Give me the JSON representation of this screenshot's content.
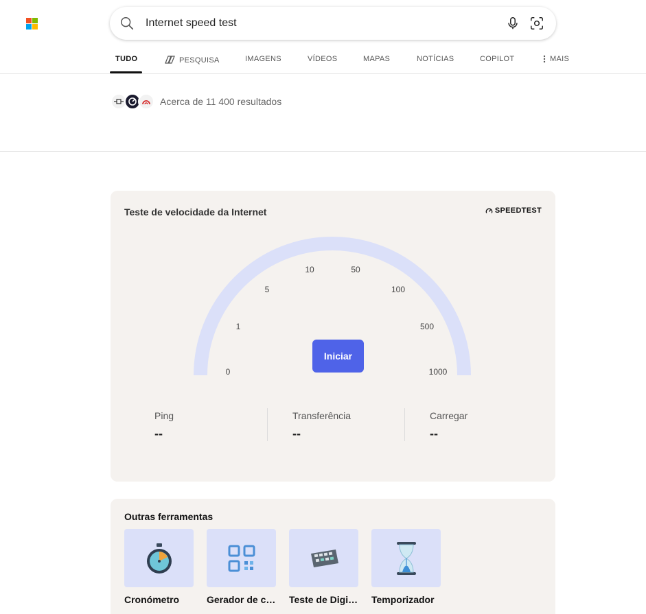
{
  "search": {
    "query": "Internet speed test"
  },
  "colors": {
    "accent": "#4f63e8",
    "gauge_track": "#dbe0f9",
    "card_bg": "#f5f2ef",
    "ms_red": "#f25022",
    "ms_green": "#7fba00",
    "ms_blue": "#00a4ef",
    "ms_yellow": "#ffb900"
  },
  "tabs": [
    {
      "label": "TUDO",
      "active": true
    },
    {
      "label": "PESQUISA",
      "icon": "copilot-search-icon"
    },
    {
      "label": "IMAGENS"
    },
    {
      "label": "VÍDEOS"
    },
    {
      "label": "MAPAS"
    },
    {
      "label": "NOTÍCIAS"
    },
    {
      "label": "COPILOT"
    },
    {
      "label": "MAIS",
      "icon": "more-vertical-icon"
    }
  ],
  "results": {
    "count_text": "Acerca de 11 400 resultados"
  },
  "speedtest": {
    "title": "Teste de velocidade da Internet",
    "brand": "SPEEDTEST",
    "ticks": [
      "0",
      "1",
      "5",
      "10",
      "50",
      "100",
      "500",
      "1000"
    ],
    "start_label": "Iniciar",
    "stats": [
      {
        "label": "Ping",
        "value": "--"
      },
      {
        "label": "Transferência",
        "value": "--"
      },
      {
        "label": "Carregar",
        "value": "--"
      }
    ]
  },
  "tools": {
    "title": "Outras ferramentas",
    "items": [
      {
        "label": "Cronómetro",
        "icon": "stopwatch-icon"
      },
      {
        "label": "Gerador de código QR",
        "icon": "qr-code-icon"
      },
      {
        "label": "Teste de Digitação",
        "icon": "keyboard-icon"
      },
      {
        "label": "Temporizador",
        "icon": "hourglass-icon"
      }
    ]
  }
}
